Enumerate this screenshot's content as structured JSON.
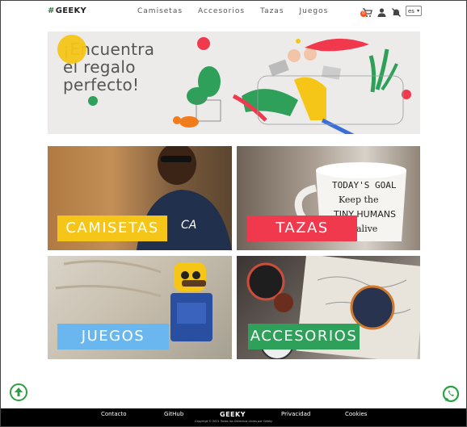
{
  "header": {
    "logo": "GEEKY",
    "nav": [
      "Camisetas",
      "Accesorios",
      "Tazas",
      "Juegos"
    ],
    "cart_count": "0",
    "language": "es"
  },
  "banner": {
    "title_lines": [
      "¡Encuentra",
      "el regalo",
      "perfecto!"
    ]
  },
  "categories": [
    {
      "label": "CAMISETAS",
      "label_bg": "#f5c518",
      "label_color": "#ffffff"
    },
    {
      "label": "TAZAS",
      "label_bg": "#f0394d",
      "label_color": "#ffffff"
    },
    {
      "label": "JUEGOS",
      "label_bg": "#6ab7f0",
      "label_color": "#ffffff"
    },
    {
      "label": "ACCESORIOS",
      "label_bg": "#2ea05a",
      "label_color": "#ffffff"
    }
  ],
  "footer": {
    "links": [
      "Contacto",
      "GitHub",
      "Privacidad",
      "Cookies"
    ],
    "logo": "GEEKY",
    "copyright": "Copyrhgt © 2021 Todos los Derechos Libres por Geeky"
  },
  "colors": {
    "brand_green": "#2e9e45",
    "whatsapp_green": "#25a244"
  }
}
